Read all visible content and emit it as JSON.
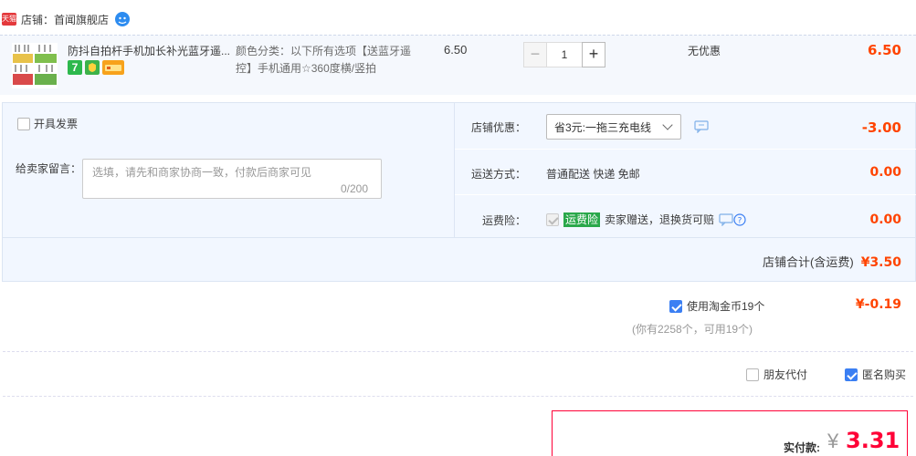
{
  "shop": {
    "badge": "天猫",
    "label": "店铺：首闻旗舰店"
  },
  "item": {
    "title": "防抖自拍杆手机加长补光蓝牙遥...",
    "sku": "颜色分类：以下所有选项【送蓝牙遥控】手机通用☆360度横/竖拍",
    "unit_price": "6.50",
    "quantity": "1",
    "discount": "无优惠",
    "total": "6.50",
    "badges": [
      "7",
      "consumer-protection-icon",
      "credit-card-icon"
    ]
  },
  "options": {
    "invoice_label": "开具发票",
    "message_label": "给卖家留言：",
    "message_placeholder": "选填，请先和商家协商一致，付款后商家可见",
    "message_count": "0/200",
    "shop_discount_label": "店铺优惠：",
    "shop_discount_value": "省3元:一拖三充电线",
    "shop_discount_amount": "-3.00",
    "shipping_label": "运送方式：",
    "shipping_value": "普通配送 快递 免邮",
    "shipping_amount": "0.00",
    "insurance_label": "运费险：",
    "insurance_badge": "运费险",
    "insurance_text": "卖家赠送，退换货可赔",
    "insurance_amount": "0.00"
  },
  "shop_total": {
    "label": "店铺合计(含运费)",
    "value": "¥3.50"
  },
  "coins": {
    "label": "使用淘金币19个",
    "amount": "¥-0.19",
    "note": "(你有2258个，可用19个)"
  },
  "friend_pay": "朋友代付",
  "anonymous": "匿名购买",
  "payment": {
    "label": "实付款:",
    "currency": "¥",
    "value": "3.31"
  },
  "colors": {
    "accent": "#ff4400",
    "pay_red": "#ff0036",
    "panel_bg": "#f2f7ff",
    "checkbox_blue": "#3b7ff3",
    "insurance_green": "#2aa84a"
  }
}
